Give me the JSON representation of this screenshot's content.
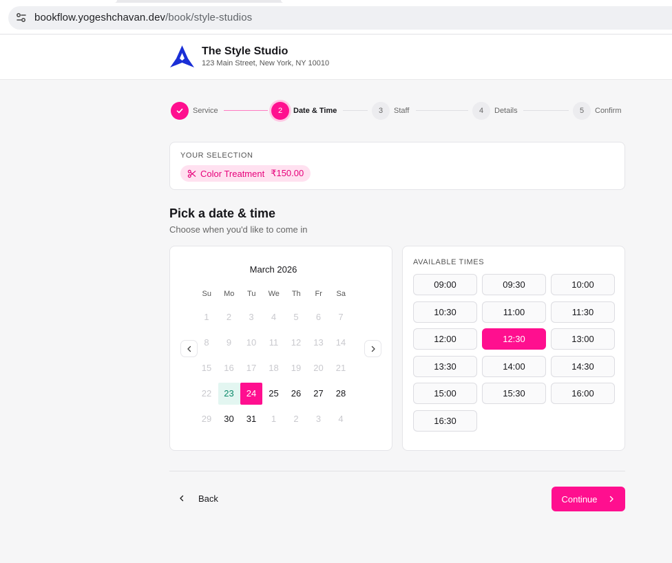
{
  "browser": {
    "url_host": "bookflow.yogeshchavan.dev",
    "url_path": "/book/style-studios"
  },
  "header": {
    "studio_name": "The Style Studio",
    "studio_address": "123 Main Street, New York, NY 10010",
    "logo_icon": "star-logo-icon"
  },
  "stepper": {
    "steps": [
      {
        "number": "1",
        "label": "Service",
        "state": "done"
      },
      {
        "number": "2",
        "label": "Date & Time",
        "state": "active"
      },
      {
        "number": "3",
        "label": "Staff",
        "state": "pending"
      },
      {
        "number": "4",
        "label": "Details",
        "state": "pending"
      },
      {
        "number": "5",
        "label": "Confirm",
        "state": "pending"
      }
    ]
  },
  "selection": {
    "title": "YOUR SELECTION",
    "service": "Color Treatment",
    "price": "₹150.00"
  },
  "picker": {
    "title": "Pick a date & time",
    "subtitle": "Choose when you'd like to come in"
  },
  "calendar": {
    "month": "March 2026",
    "weekdays": [
      "Su",
      "Mo",
      "Tu",
      "We",
      "Th",
      "Fr",
      "Sa"
    ],
    "weeks": [
      [
        {
          "d": "1",
          "s": "muted"
        },
        {
          "d": "2",
          "s": "muted"
        },
        {
          "d": "3",
          "s": "muted"
        },
        {
          "d": "4",
          "s": "muted"
        },
        {
          "d": "5",
          "s": "muted"
        },
        {
          "d": "6",
          "s": "muted"
        },
        {
          "d": "7",
          "s": "muted"
        }
      ],
      [
        {
          "d": "8",
          "s": "muted"
        },
        {
          "d": "9",
          "s": "muted"
        },
        {
          "d": "10",
          "s": "muted"
        },
        {
          "d": "11",
          "s": "muted"
        },
        {
          "d": "12",
          "s": "muted"
        },
        {
          "d": "13",
          "s": "muted"
        },
        {
          "d": "14",
          "s": "muted"
        }
      ],
      [
        {
          "d": "15",
          "s": "muted"
        },
        {
          "d": "16",
          "s": "muted"
        },
        {
          "d": "17",
          "s": "muted"
        },
        {
          "d": "18",
          "s": "muted"
        },
        {
          "d": "19",
          "s": "muted"
        },
        {
          "d": "20",
          "s": "muted"
        },
        {
          "d": "21",
          "s": "muted"
        }
      ],
      [
        {
          "d": "22",
          "s": "muted"
        },
        {
          "d": "23",
          "s": "today"
        },
        {
          "d": "24",
          "s": "selected"
        },
        {
          "d": "25",
          "s": "normal"
        },
        {
          "d": "26",
          "s": "normal"
        },
        {
          "d": "27",
          "s": "normal"
        },
        {
          "d": "28",
          "s": "normal"
        }
      ],
      [
        {
          "d": "29",
          "s": "muted"
        },
        {
          "d": "30",
          "s": "normal"
        },
        {
          "d": "31",
          "s": "normal"
        },
        {
          "d": "1",
          "s": "muted"
        },
        {
          "d": "2",
          "s": "muted"
        },
        {
          "d": "3",
          "s": "muted"
        },
        {
          "d": "4",
          "s": "muted"
        }
      ]
    ],
    "selected_date": "24",
    "today": "23"
  },
  "times": {
    "title": "AVAILABLE TIMES",
    "slots": [
      "09:00",
      "09:30",
      "10:00",
      "10:30",
      "11:00",
      "11:30",
      "12:00",
      "12:30",
      "13:00",
      "13:30",
      "14:00",
      "14:30",
      "15:00",
      "15:30",
      "16:00",
      "16:30"
    ],
    "selected": "12:30"
  },
  "footer": {
    "back_label": "Back",
    "continue_label": "Continue"
  },
  "colors": {
    "accent": "#ff0f8f",
    "accent_soft": "#ffe1f0",
    "today_bg": "#e3f6f1",
    "logo_blue": "#1a2fd6"
  }
}
